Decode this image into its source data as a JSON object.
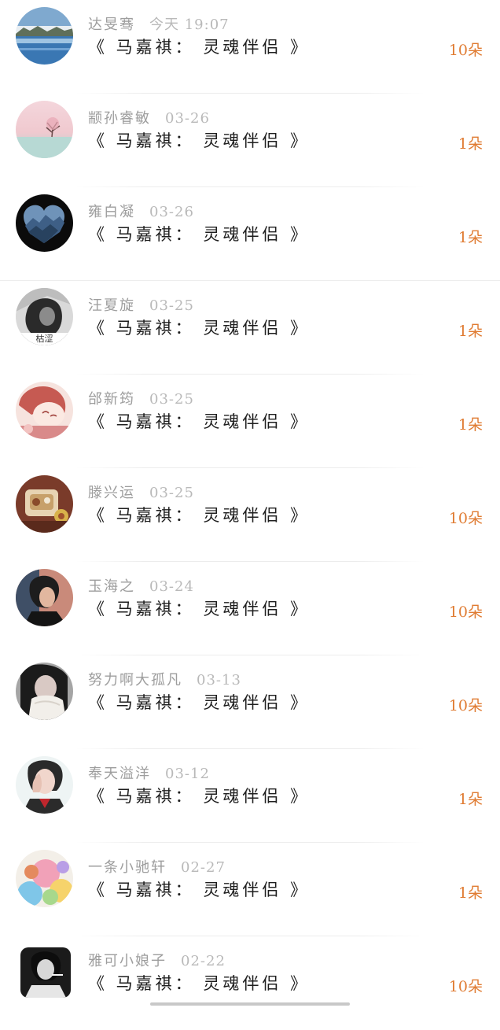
{
  "items": [
    {
      "name": "达旻骞",
      "time": "今天 19:07",
      "title": "《 马嘉祺： 灵魂伴侣 》",
      "count": "10朵",
      "avatar": "avatar-lake"
    },
    {
      "name": "颛孙睿敏",
      "time": "03-26",
      "title": "《 马嘉祺： 灵魂伴侣 》",
      "count": "1朵",
      "avatar": "avatar-pink-tree"
    },
    {
      "name": "雍白凝",
      "time": "03-26",
      "title": "《 马嘉祺： 灵魂伴侣 》",
      "count": "1朵",
      "avatar": "avatar-heart-mountains"
    },
    {
      "name": "汪夏旋",
      "time": "03-25",
      "title": "《 马嘉祺： 灵魂伴侣 》",
      "count": "1朵",
      "avatar": "avatar-person-bw",
      "avatar_caption": "枯涩"
    },
    {
      "name": "邰新筠",
      "time": "03-25",
      "title": "《 马嘉祺： 灵魂伴侣 》",
      "count": "1朵",
      "avatar": "avatar-anime-girl"
    },
    {
      "name": "滕兴运",
      "time": "03-25",
      "title": "《 马嘉祺： 灵魂伴侣 》",
      "count": "10朵",
      "avatar": "avatar-food"
    },
    {
      "name": "玉海之",
      "time": "03-24",
      "title": "《 马嘉祺： 灵魂伴侣 》",
      "count": "10朵",
      "avatar": "avatar-man-portrait"
    },
    {
      "name": "努力啊大孤凡",
      "time": "03-13",
      "title": "《 马嘉祺： 灵魂伴侣 》",
      "count": "10朵",
      "avatar": "avatar-girl-scarf"
    },
    {
      "name": "奉天溢洋",
      "time": "03-12",
      "title": "《 马嘉祺： 灵魂伴侣 》",
      "count": "1朵",
      "avatar": "avatar-idol"
    },
    {
      "name": "一条小驰轩",
      "time": "02-27",
      "title": "《 马嘉祺： 灵魂伴侣 》",
      "count": "1朵",
      "avatar": "avatar-balloons"
    },
    {
      "name": "雅可小娘子",
      "time": "02-22",
      "title": "《 马嘉祺： 灵魂伴侣 》",
      "count": "10朵",
      "avatar": "avatar-bw-smoker"
    }
  ]
}
